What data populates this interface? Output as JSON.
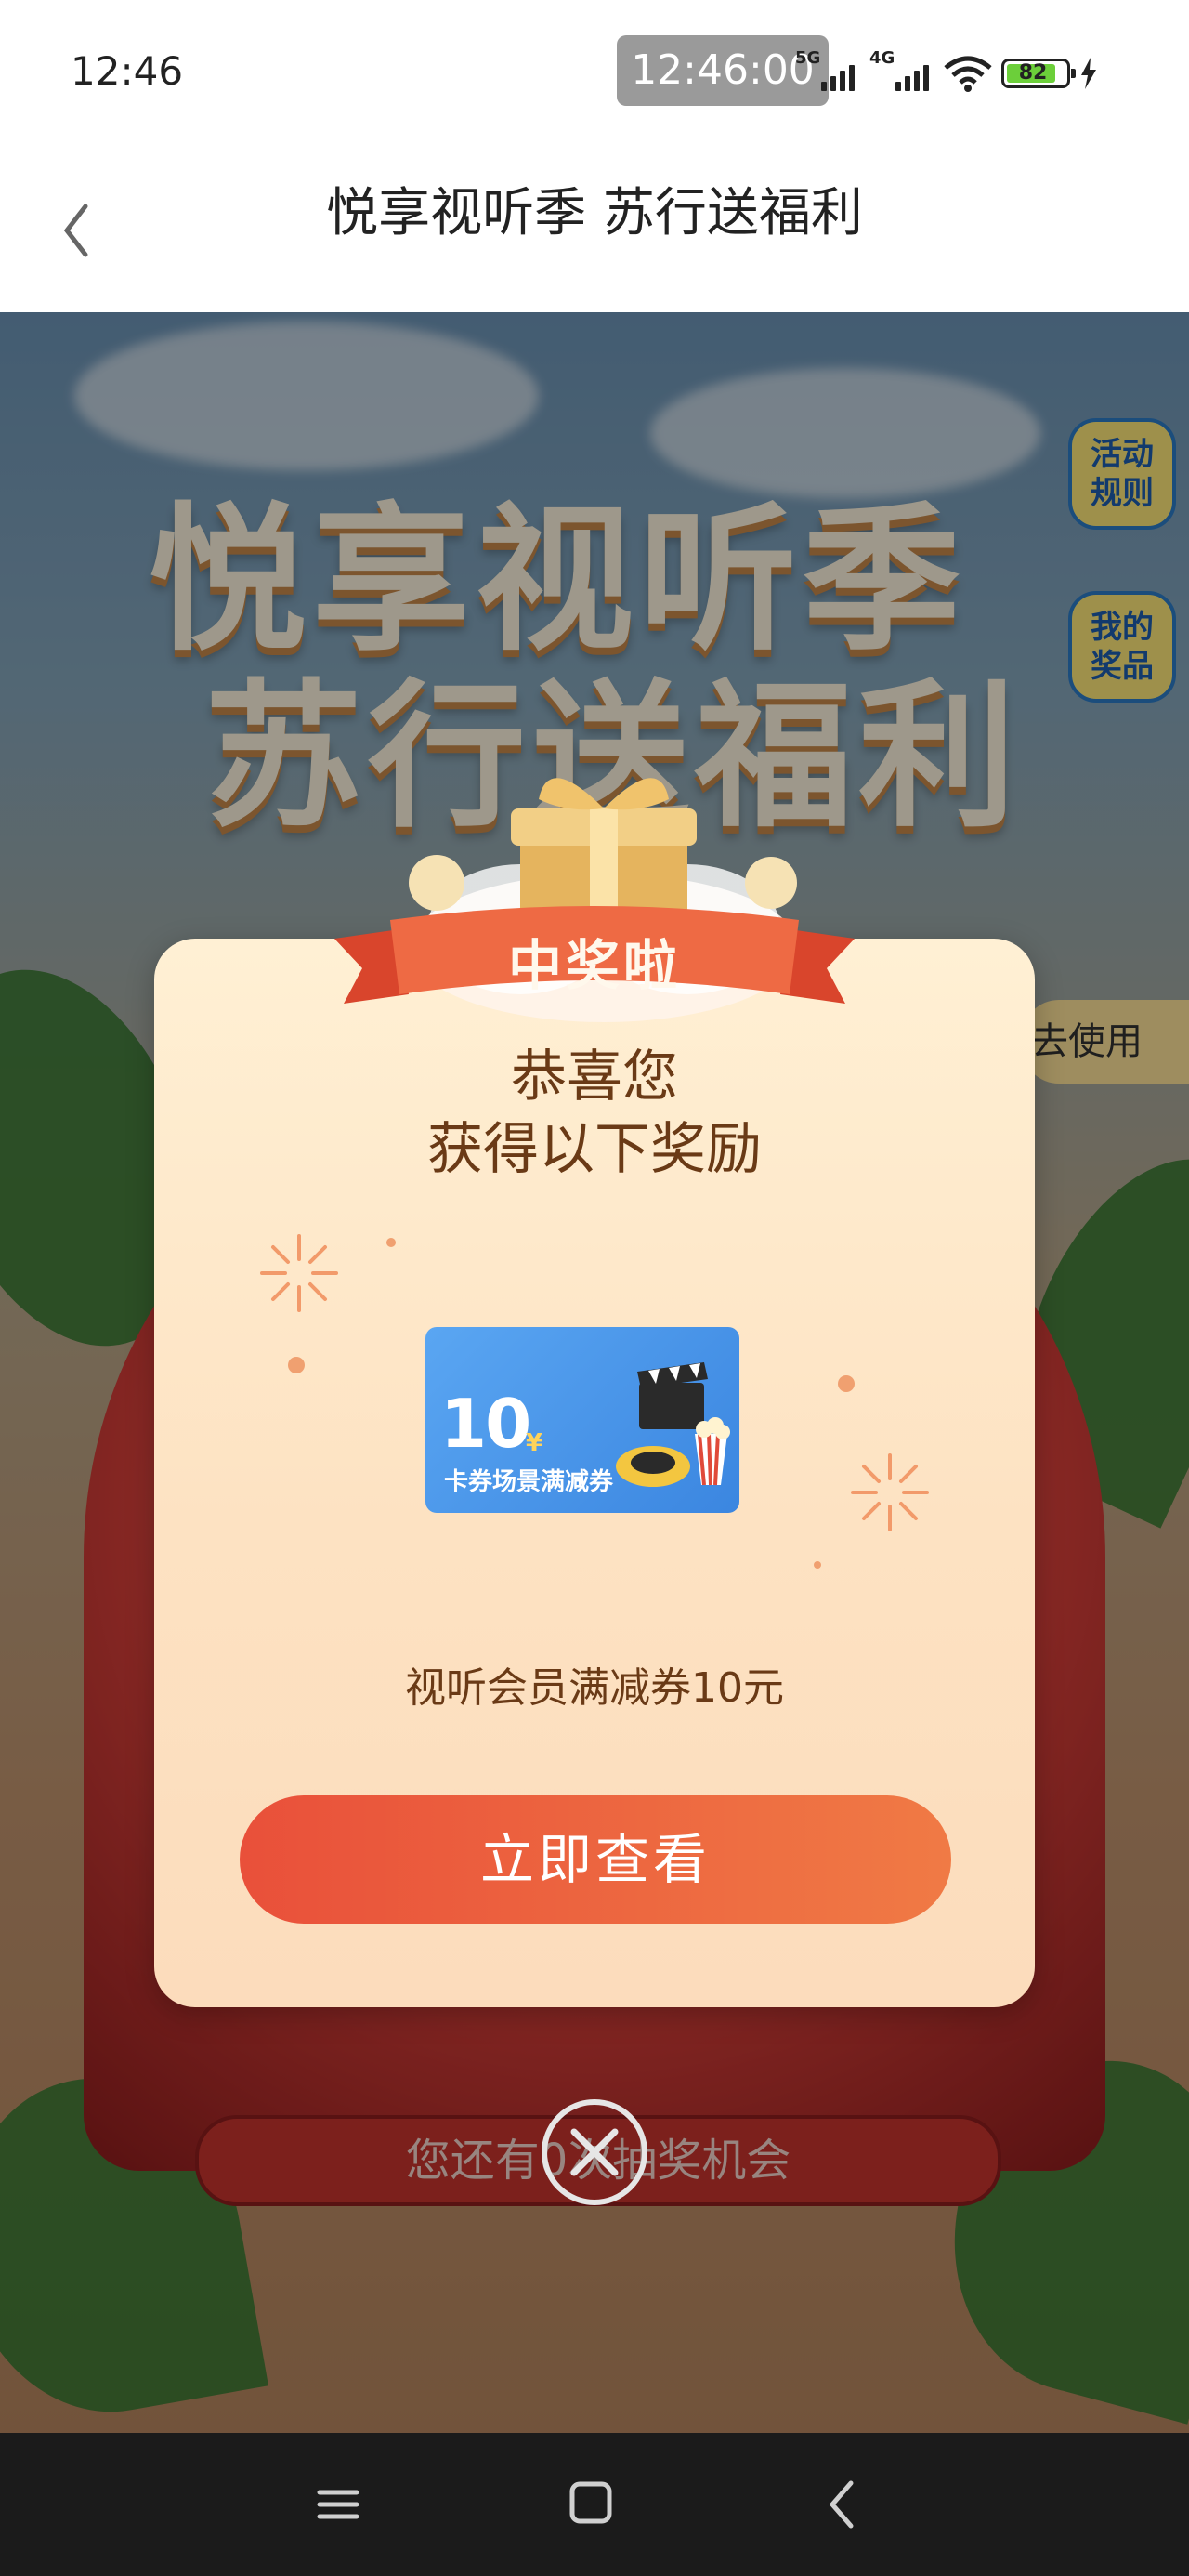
{
  "status_bar": {
    "time": "12:46",
    "overlay_time": "12:46:00",
    "signal1_label": "5G",
    "signal2_label": "4G",
    "battery": "82"
  },
  "header": {
    "title": "悦享视听季 苏行送福利",
    "back_icon": "chevron-left-icon"
  },
  "background": {
    "title_line1": "悦享视听季",
    "title_line2": "苏行送福利",
    "rules_button": "活动\n规则",
    "my_prizes_button": "我的\n奖品",
    "go_use": "去使用",
    "chances_text": "您还有0次抽奖机会"
  },
  "modal": {
    "ribbon": "中奖啦",
    "congrats_line1": "恭喜您",
    "congrats_line2": "获得以下奖励",
    "voucher": {
      "amount": "10",
      "currency": "¥",
      "label": "卡券场景满减券"
    },
    "prize_name": "视听会员满减券10元",
    "view_button": "立即查看",
    "close_icon": "close-circle-icon"
  },
  "nav_bar": {
    "menu_icon": "menu-icon",
    "home_icon": "home-square-icon",
    "back_icon": "back-triangle-icon"
  },
  "colors": {
    "accent": "#e9503a",
    "modal_bg": "#fde6c8",
    "text_brown": "#6a3a16",
    "voucher_blue": "#3b86e0"
  }
}
